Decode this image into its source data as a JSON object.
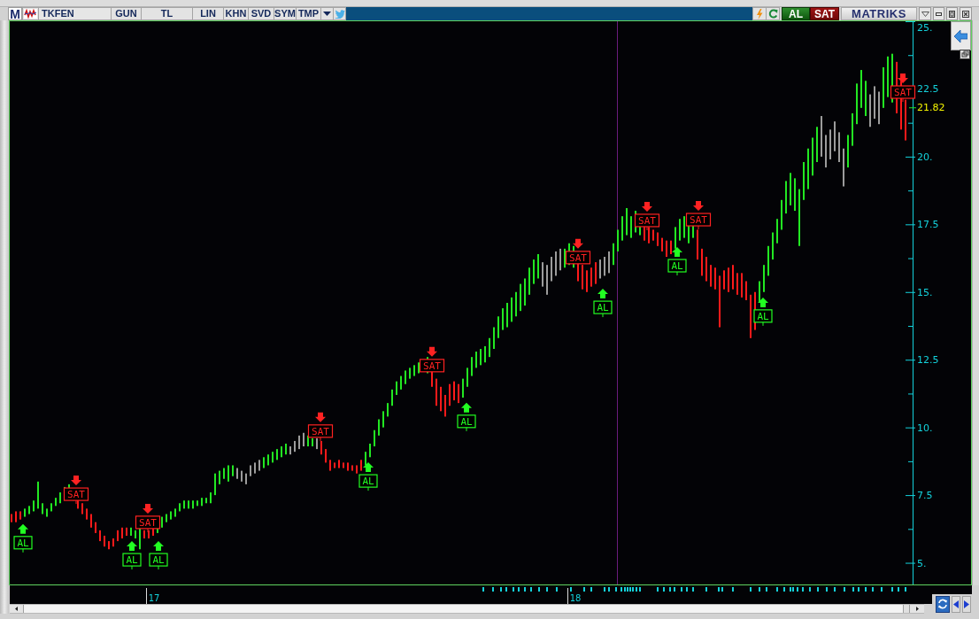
{
  "toolbar": {
    "logo": "M",
    "symbol": "TKFEN",
    "buttons": [
      "GUN",
      "TL",
      "LIN",
      "KHN",
      "SVD",
      "SYM",
      "TMP"
    ]
  },
  "quick_actions": {
    "buy": "AL",
    "sell": "SAT",
    "brand": "MATRIKS"
  },
  "chart": {
    "y_axis_labels": [
      "25.",
      "22.5",
      "20.",
      "17.5",
      "15.",
      "12.5",
      "10.",
      "7.5",
      "5."
    ],
    "last_price": "21.82",
    "signals": [
      {
        "kind": "buy",
        "label": "AL"
      },
      {
        "kind": "sell",
        "label": "SAT"
      },
      {
        "kind": "buy",
        "label": "AL"
      },
      {
        "kind": "sell",
        "label": "SAT"
      },
      {
        "kind": "buy",
        "label": "AL"
      },
      {
        "kind": "sell",
        "label": "SAT"
      },
      {
        "kind": "buy",
        "label": "AL"
      },
      {
        "kind": "sell",
        "label": "SAT"
      },
      {
        "kind": "buy",
        "label": "AL"
      },
      {
        "kind": "sell",
        "label": "SAT"
      },
      {
        "kind": "buy",
        "label": "AL"
      },
      {
        "kind": "sell",
        "label": "SAT"
      },
      {
        "kind": "buy",
        "label": "AL"
      },
      {
        "kind": "sell",
        "label": "SAT"
      },
      {
        "kind": "buy",
        "label": "AL"
      },
      {
        "kind": "sell",
        "label": "SAT"
      }
    ],
    "time_labels": [
      "17",
      "18"
    ]
  }
}
